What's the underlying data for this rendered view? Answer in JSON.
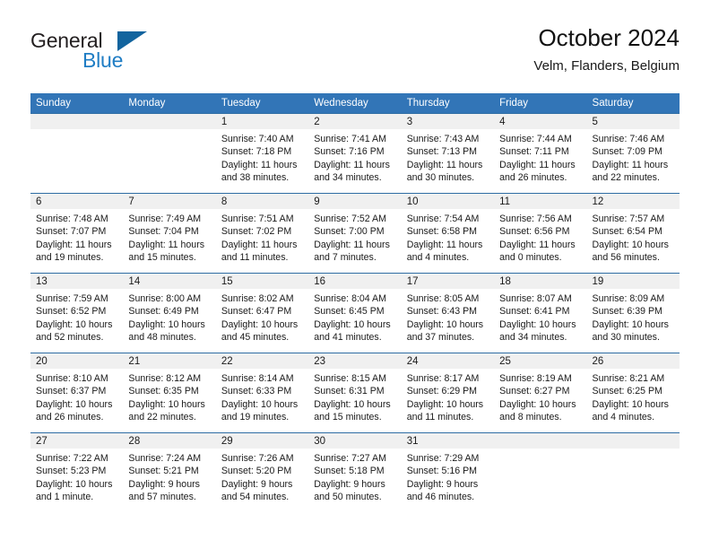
{
  "brand": {
    "name_part1": "General",
    "name_part2": "Blue",
    "flag_icon": "blue-triangle-flag-icon",
    "accent_color": "#1f7dc4",
    "flag_color": "#12649e"
  },
  "header": {
    "title": "October 2024",
    "subtitle": "Velm, Flanders, Belgium"
  },
  "calendar": {
    "header_bg": "#3275b7",
    "header_text_color": "#ffffff",
    "daynum_band_bg": "#f0f0f0",
    "grid_line_color": "#2e6da4",
    "weekday_headers": [
      "Sunday",
      "Monday",
      "Tuesday",
      "Wednesday",
      "Thursday",
      "Friday",
      "Saturday"
    ],
    "weeks": [
      [
        {
          "day": "",
          "lines": []
        },
        {
          "day": "",
          "lines": []
        },
        {
          "day": "1",
          "lines": [
            "Sunrise: 7:40 AM",
            "Sunset: 7:18 PM",
            "Daylight: 11 hours",
            "and 38 minutes."
          ]
        },
        {
          "day": "2",
          "lines": [
            "Sunrise: 7:41 AM",
            "Sunset: 7:16 PM",
            "Daylight: 11 hours",
            "and 34 minutes."
          ]
        },
        {
          "day": "3",
          "lines": [
            "Sunrise: 7:43 AM",
            "Sunset: 7:13 PM",
            "Daylight: 11 hours",
            "and 30 minutes."
          ]
        },
        {
          "day": "4",
          "lines": [
            "Sunrise: 7:44 AM",
            "Sunset: 7:11 PM",
            "Daylight: 11 hours",
            "and 26 minutes."
          ]
        },
        {
          "day": "5",
          "lines": [
            "Sunrise: 7:46 AM",
            "Sunset: 7:09 PM",
            "Daylight: 11 hours",
            "and 22 minutes."
          ]
        }
      ],
      [
        {
          "day": "6",
          "lines": [
            "Sunrise: 7:48 AM",
            "Sunset: 7:07 PM",
            "Daylight: 11 hours",
            "and 19 minutes."
          ]
        },
        {
          "day": "7",
          "lines": [
            "Sunrise: 7:49 AM",
            "Sunset: 7:04 PM",
            "Daylight: 11 hours",
            "and 15 minutes."
          ]
        },
        {
          "day": "8",
          "lines": [
            "Sunrise: 7:51 AM",
            "Sunset: 7:02 PM",
            "Daylight: 11 hours",
            "and 11 minutes."
          ]
        },
        {
          "day": "9",
          "lines": [
            "Sunrise: 7:52 AM",
            "Sunset: 7:00 PM",
            "Daylight: 11 hours",
            "and 7 minutes."
          ]
        },
        {
          "day": "10",
          "lines": [
            "Sunrise: 7:54 AM",
            "Sunset: 6:58 PM",
            "Daylight: 11 hours",
            "and 4 minutes."
          ]
        },
        {
          "day": "11",
          "lines": [
            "Sunrise: 7:56 AM",
            "Sunset: 6:56 PM",
            "Daylight: 11 hours",
            "and 0 minutes."
          ]
        },
        {
          "day": "12",
          "lines": [
            "Sunrise: 7:57 AM",
            "Sunset: 6:54 PM",
            "Daylight: 10 hours",
            "and 56 minutes."
          ]
        }
      ],
      [
        {
          "day": "13",
          "lines": [
            "Sunrise: 7:59 AM",
            "Sunset: 6:52 PM",
            "Daylight: 10 hours",
            "and 52 minutes."
          ]
        },
        {
          "day": "14",
          "lines": [
            "Sunrise: 8:00 AM",
            "Sunset: 6:49 PM",
            "Daylight: 10 hours",
            "and 48 minutes."
          ]
        },
        {
          "day": "15",
          "lines": [
            "Sunrise: 8:02 AM",
            "Sunset: 6:47 PM",
            "Daylight: 10 hours",
            "and 45 minutes."
          ]
        },
        {
          "day": "16",
          "lines": [
            "Sunrise: 8:04 AM",
            "Sunset: 6:45 PM",
            "Daylight: 10 hours",
            "and 41 minutes."
          ]
        },
        {
          "day": "17",
          "lines": [
            "Sunrise: 8:05 AM",
            "Sunset: 6:43 PM",
            "Daylight: 10 hours",
            "and 37 minutes."
          ]
        },
        {
          "day": "18",
          "lines": [
            "Sunrise: 8:07 AM",
            "Sunset: 6:41 PM",
            "Daylight: 10 hours",
            "and 34 minutes."
          ]
        },
        {
          "day": "19",
          "lines": [
            "Sunrise: 8:09 AM",
            "Sunset: 6:39 PM",
            "Daylight: 10 hours",
            "and 30 minutes."
          ]
        }
      ],
      [
        {
          "day": "20",
          "lines": [
            "Sunrise: 8:10 AM",
            "Sunset: 6:37 PM",
            "Daylight: 10 hours",
            "and 26 minutes."
          ]
        },
        {
          "day": "21",
          "lines": [
            "Sunrise: 8:12 AM",
            "Sunset: 6:35 PM",
            "Daylight: 10 hours",
            "and 22 minutes."
          ]
        },
        {
          "day": "22",
          "lines": [
            "Sunrise: 8:14 AM",
            "Sunset: 6:33 PM",
            "Daylight: 10 hours",
            "and 19 minutes."
          ]
        },
        {
          "day": "23",
          "lines": [
            "Sunrise: 8:15 AM",
            "Sunset: 6:31 PM",
            "Daylight: 10 hours",
            "and 15 minutes."
          ]
        },
        {
          "day": "24",
          "lines": [
            "Sunrise: 8:17 AM",
            "Sunset: 6:29 PM",
            "Daylight: 10 hours",
            "and 11 minutes."
          ]
        },
        {
          "day": "25",
          "lines": [
            "Sunrise: 8:19 AM",
            "Sunset: 6:27 PM",
            "Daylight: 10 hours",
            "and 8 minutes."
          ]
        },
        {
          "day": "26",
          "lines": [
            "Sunrise: 8:21 AM",
            "Sunset: 6:25 PM",
            "Daylight: 10 hours",
            "and 4 minutes."
          ]
        }
      ],
      [
        {
          "day": "27",
          "lines": [
            "Sunrise: 7:22 AM",
            "Sunset: 5:23 PM",
            "Daylight: 10 hours",
            "and 1 minute."
          ]
        },
        {
          "day": "28",
          "lines": [
            "Sunrise: 7:24 AM",
            "Sunset: 5:21 PM",
            "Daylight: 9 hours",
            "and 57 minutes."
          ]
        },
        {
          "day": "29",
          "lines": [
            "Sunrise: 7:26 AM",
            "Sunset: 5:20 PM",
            "Daylight: 9 hours",
            "and 54 minutes."
          ]
        },
        {
          "day": "30",
          "lines": [
            "Sunrise: 7:27 AM",
            "Sunset: 5:18 PM",
            "Daylight: 9 hours",
            "and 50 minutes."
          ]
        },
        {
          "day": "31",
          "lines": [
            "Sunrise: 7:29 AM",
            "Sunset: 5:16 PM",
            "Daylight: 9 hours",
            "and 46 minutes."
          ]
        },
        {
          "day": "",
          "lines": []
        },
        {
          "day": "",
          "lines": []
        }
      ]
    ]
  }
}
